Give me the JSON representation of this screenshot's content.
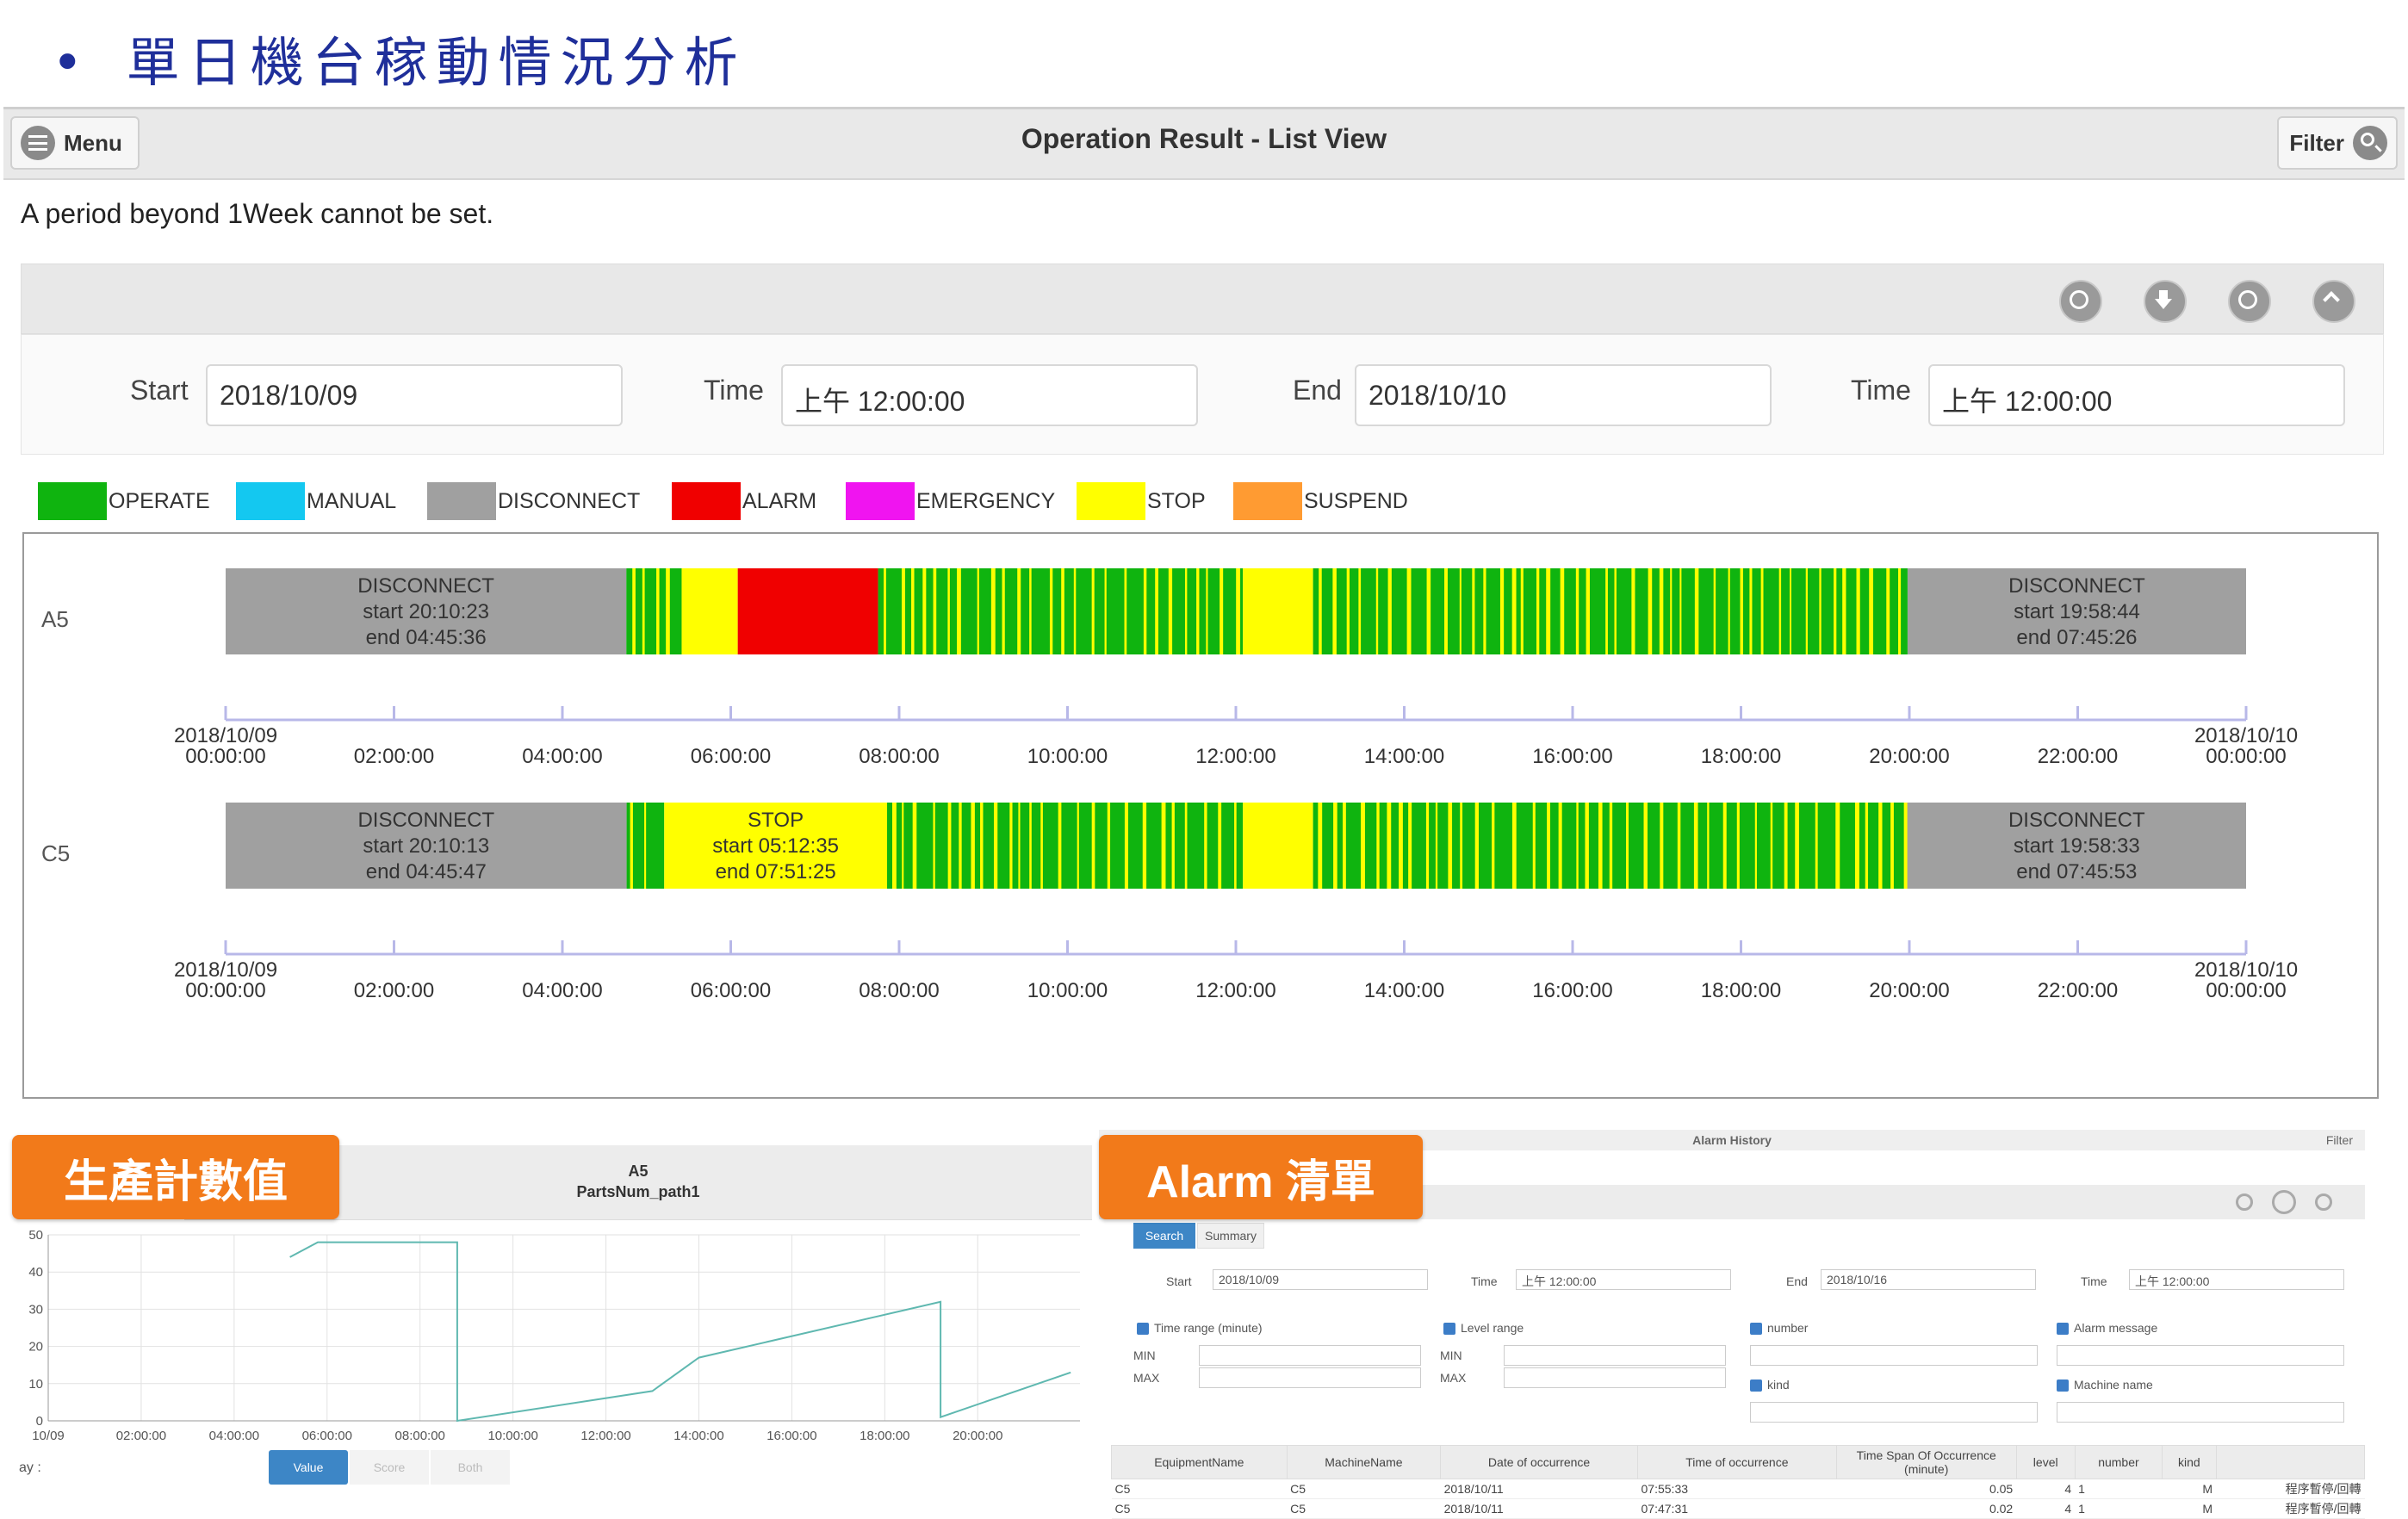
{
  "slide": {
    "bullet": "•",
    "title": "單日機台稼動情況分析"
  },
  "header": {
    "menu_label": "Menu",
    "title": "Operation Result - List View",
    "filter_label": "Filter"
  },
  "warning": "A period beyond 1Week cannot be set.",
  "toolbar_icons": [
    "clock-icon",
    "download-icon",
    "refresh-icon",
    "collapse-icon"
  ],
  "form": {
    "start_label": "Start",
    "start_value": "2018/10/09",
    "time1_label": "Time",
    "time1_value": "上午 12:00:00",
    "end_label": "End",
    "end_value": "2018/10/10",
    "time2_label": "Time",
    "time2_value": "上午 12:00:00"
  },
  "colors": {
    "OPERATE": "#0fb40f",
    "MANUAL": "#14c8f0",
    "DISCONNECT": "#a0a0a0",
    "ALARM": "#f00000",
    "EMERGENCY": "#f014f0",
    "STOP": "#ffff00",
    "SUSPEND": "#ff9b32"
  },
  "legend": [
    "OPERATE",
    "MANUAL",
    "DISCONNECT",
    "ALARM",
    "EMERGENCY",
    "STOP",
    "SUSPEND"
  ],
  "chart_data": [
    {
      "type": "timeline",
      "machine": "A5",
      "x_range": [
        "2018/10/09 00:00:00",
        "2018/10/10 00:00:00"
      ],
      "segments": [
        {
          "state": "DISCONNECT",
          "start": "00:00",
          "end": "04:45:36",
          "label": [
            "DISCONNECT",
            "start 20:10:23",
            "end  04:45:36"
          ]
        },
        {
          "state": "OPERATE",
          "start": "04:45:36",
          "end": "05:25",
          "pattern": "striped"
        },
        {
          "state": "STOP",
          "start": "05:25",
          "end": "06:05"
        },
        {
          "state": "ALARM",
          "start": "06:05",
          "end": "07:45"
        },
        {
          "state": "OPERATE",
          "start": "07:45",
          "end": "12:05",
          "pattern": "striped"
        },
        {
          "state": "STOP",
          "start": "12:05",
          "end": "12:55"
        },
        {
          "state": "OPERATE",
          "start": "12:55",
          "end": "19:58:44",
          "pattern": "striped"
        },
        {
          "state": "DISCONNECT",
          "start": "19:58:44",
          "end": "24:00",
          "label": [
            "DISCONNECT",
            "start 19:58:44",
            "end  07:45:26"
          ]
        }
      ]
    },
    {
      "type": "timeline",
      "machine": "C5",
      "x_range": [
        "2018/10/09 00:00:00",
        "2018/10/10 00:00:00"
      ],
      "segments": [
        {
          "state": "DISCONNECT",
          "start": "00:00",
          "end": "04:45:47",
          "label": [
            "DISCONNECT",
            "start 20:10:13",
            "end  04:45:47"
          ]
        },
        {
          "state": "OPERATE",
          "start": "04:45:47",
          "end": "05:12:35",
          "pattern": "striped"
        },
        {
          "state": "STOP",
          "start": "05:12:35",
          "end": "07:51:25",
          "label": [
            "STOP",
            "start 05:12:35",
            "end  07:51:25"
          ]
        },
        {
          "state": "OPERATE",
          "start": "07:51:25",
          "end": "12:05",
          "pattern": "striped"
        },
        {
          "state": "STOP",
          "start": "12:05",
          "end": "12:55"
        },
        {
          "state": "OPERATE",
          "start": "12:55",
          "end": "19:58:33",
          "pattern": "striped"
        },
        {
          "state": "DISCONNECT",
          "start": "19:58:33",
          "end": "24:00",
          "label": [
            "DISCONNECT",
            "start 19:58:33",
            "end  07:45:53"
          ]
        }
      ]
    },
    {
      "type": "line",
      "title": "A5",
      "subtitle": "PartsNum_path1",
      "ylim": [
        0,
        50
      ],
      "yticks": [
        0,
        10,
        20,
        30,
        40,
        50
      ],
      "xtick_labels": [
        "10/09",
        "02:00:00",
        "04:00:00",
        "06:00:00",
        "08:00:00",
        "10:00:00",
        "12:00:00",
        "14:00:00",
        "16:00:00",
        "18:00:00",
        "20:00:00"
      ],
      "x_hours": [
        5.2,
        5.8,
        8.8,
        8.8,
        13.0,
        14.0,
        19.2,
        19.2,
        22.0
      ],
      "values": [
        44,
        48,
        48,
        0,
        8,
        17,
        32,
        1,
        13
      ]
    }
  ],
  "timeline_axis": {
    "ticks": [
      "2018/10/09\n00:00:00",
      "02:00:00",
      "04:00:00",
      "06:00:00",
      "08:00:00",
      "10:00:00",
      "12:00:00",
      "14:00:00",
      "16:00:00",
      "18:00:00",
      "20:00:00",
      "22:00:00",
      "2018/10/10\n00:00:00"
    ]
  },
  "parts_panel": {
    "tag": "生產計數值",
    "title": "A5",
    "subtitle": "PartsNum_path1",
    "display_label": "ay :",
    "buttons": [
      "Value",
      "Score",
      "Both"
    ]
  },
  "alarm_panel": {
    "tag": "Alarm 清單",
    "title": "Alarm History",
    "filter": "Filter",
    "tabs": [
      "Search",
      "Summary"
    ],
    "start_label": "Start",
    "start_value": "2018/10/09",
    "time_label": "Time",
    "time_value": "上午 12:00:00",
    "end_label": "End",
    "end_value": "2018/10/16",
    "time2_label": "Time",
    "time2_value": "上午 12:00:00",
    "checks": [
      "Time range (minute)",
      "Level range",
      "number",
      "Alarm message",
      "kind",
      "Machine name"
    ],
    "min_label": "MIN",
    "max_label": "MAX",
    "columns": [
      "EquipmentName",
      "MachineName",
      "Date of occurrence",
      "Time of occurrence",
      "Time Span Of Occurrence (minute)",
      "level",
      "number",
      "kind",
      ""
    ],
    "rows": [
      [
        "C5",
        "C5",
        "2018/10/11",
        "07:55:33",
        "0.05",
        "4",
        "1",
        "M",
        "程序暫停/回轉"
      ],
      [
        "C5",
        "C5",
        "2018/10/11",
        "07:47:31",
        "0.02",
        "4",
        "1",
        "M",
        "程序暫停/回轉"
      ]
    ]
  }
}
